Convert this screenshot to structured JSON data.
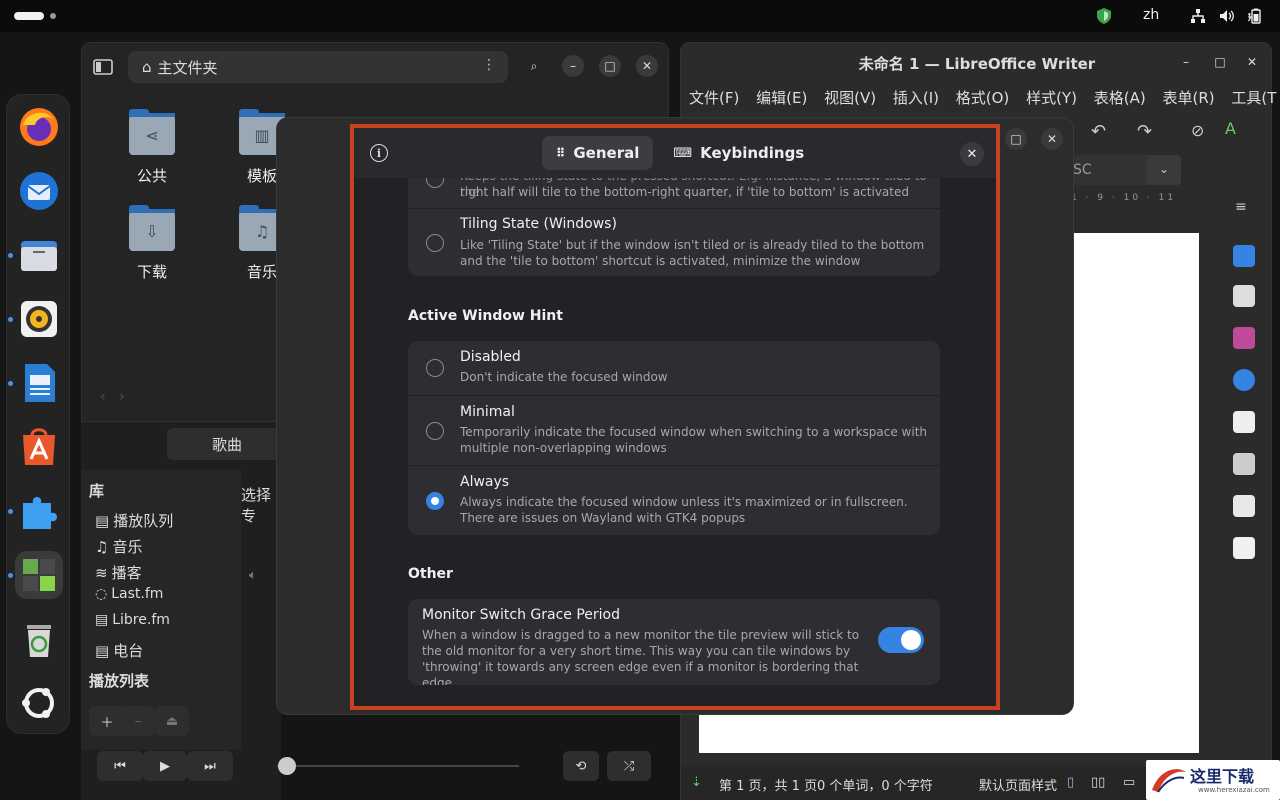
{
  "topbar": {
    "language": "zh"
  },
  "dock": {
    "apps": [
      "firefox",
      "thunderbird",
      "files",
      "rhythmbox",
      "libreoffice-writer",
      "app-center",
      "extensions",
      "extension-manager",
      "trash",
      "show-apps"
    ]
  },
  "files": {
    "path": "主文件夹",
    "folders": [
      {
        "label": "公共",
        "icon": "share-icon"
      },
      {
        "label": "模板",
        "icon": "template-icon"
      },
      {
        "label": "下载",
        "icon": "download-icon"
      },
      {
        "label": "音乐",
        "icon": "music-icon"
      }
    ]
  },
  "music": {
    "songs_tab": "歌曲",
    "library_title": "库",
    "library_items": [
      "播放队列",
      "音乐",
      "播客",
      "Last.fm",
      "Libre.fm",
      "电台"
    ],
    "playlists_title": "播放列表",
    "select_label": "选择专"
  },
  "writer": {
    "title": "未命名 1 — LibreOffice Writer",
    "menu": [
      "文件(F)",
      "编辑(E)",
      "视图(V)",
      "插入(I)",
      "格式(O)",
      "样式(Y)",
      "表格(A)",
      "表单(R)",
      "工具(T"
    ],
    "font_partial": "SC",
    "status": {
      "page": "第 1 页，共 1 页",
      "words": "0 个单词，0 个字符",
      "page_style": "默认页面样式"
    }
  },
  "dialog": {
    "tabs": [
      {
        "label": "General",
        "icon": "grid-icon",
        "active": true
      },
      {
        "label": "Keybindings",
        "icon": "keyboard-icon",
        "active": false
      }
    ],
    "top_partial_subtitle": "right half will tile to the bottom-right quarter, if 'tile to bottom' is activated",
    "top_partial_prefix": "Keeps the tiling state to the pressed shortcut. E.g. instance, a window tiled to the",
    "tiling_windows": {
      "title": "Tiling State (Windows)",
      "subtitle": "Like 'Tiling State' but if the window isn't tiled or is already tiled to the bottom and the 'tile to bottom' shortcut is activated, minimize the window"
    },
    "active_window_hint": {
      "heading": "Active Window Hint",
      "options": [
        {
          "title": "Disabled",
          "subtitle": "Don't indicate the focused window",
          "selected": false
        },
        {
          "title": "Minimal",
          "subtitle": "Temporarily indicate the focused window when switching to a workspace with multiple non-overlapping windows",
          "selected": false
        },
        {
          "title": "Always",
          "subtitle": "Always indicate the focused window unless it's maximized or in fullscreen. There are issues on Wayland with GTK4 popups",
          "selected": true
        }
      ]
    },
    "other": {
      "heading": "Other",
      "grace_title": "Monitor Switch Grace Period",
      "grace_subtitle": "When a window is dragged to a new monitor the tile preview will stick to the old monitor for a very short time. This way you can tile windows by 'throwing' it towards any screen edge even if a monitor is bordering that edge.",
      "grace_enabled": true
    }
  },
  "watermark": {
    "text": "这里下载",
    "url": "www.herexiazai.com"
  }
}
